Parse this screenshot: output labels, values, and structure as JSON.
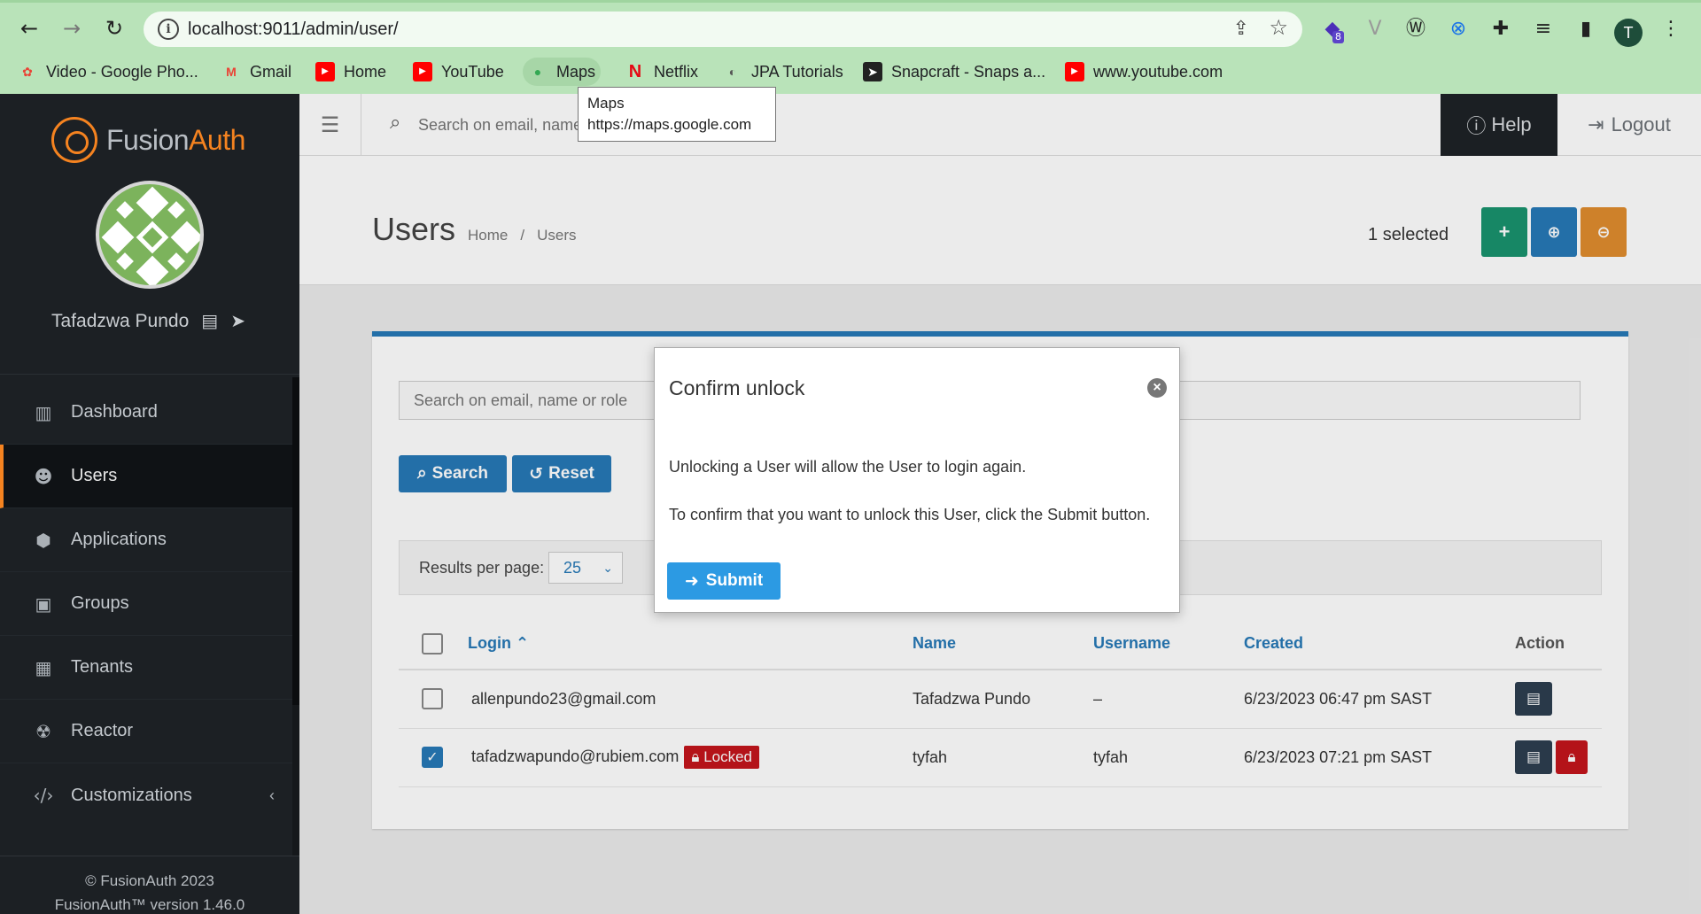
{
  "browser": {
    "url": "localhost:9011/admin/user/",
    "bookmarks": [
      {
        "label": "Video - Google Pho..."
      },
      {
        "label": "Gmail"
      },
      {
        "label": "Home"
      },
      {
        "label": "YouTube"
      },
      {
        "label": "Maps"
      },
      {
        "label": "Netflix"
      },
      {
        "label": "JPA Tutorials"
      },
      {
        "label": "Snapcraft - Snaps a..."
      },
      {
        "label": "www.youtube.com"
      }
    ],
    "extension_badge": "8",
    "profile_initial": "T",
    "tooltip": {
      "title": "Maps",
      "url": "https://maps.google.com"
    }
  },
  "sidebar": {
    "logo_a": "Fusion",
    "logo_b": "Auth",
    "user_name": "Tafadzwa Pundo",
    "items": [
      {
        "label": "Dashboard",
        "icon": "columns-icon"
      },
      {
        "label": "Users",
        "icon": "users-icon"
      },
      {
        "label": "Applications",
        "icon": "cube-icon"
      },
      {
        "label": "Groups",
        "icon": "object-group-icon"
      },
      {
        "label": "Tenants",
        "icon": "building-icon"
      },
      {
        "label": "Reactor",
        "icon": "radiation-icon"
      },
      {
        "label": "Customizations",
        "icon": "code-icon"
      }
    ],
    "footer_line1": "© FusionAuth 2023",
    "footer_line2": "FusionAuth™ version 1.46.0"
  },
  "topbar": {
    "search_placeholder": "Search on email, name or role",
    "help_label": "Help",
    "logout_label": "Logout"
  },
  "page": {
    "title": "Users",
    "breadcrumb_home": "Home",
    "breadcrumb_sep": "/",
    "breadcrumb_current": "Users",
    "selected_count": "1",
    "selected_text": "selected",
    "colors": {
      "add": "#19936e",
      "unlock": "#2779b7",
      "lock": "#e08d2e"
    }
  },
  "search": {
    "placeholder": "Search on email, name or role",
    "search_label": "Search",
    "reset_label": "Reset"
  },
  "results": {
    "label": "Results per page:",
    "value": "25"
  },
  "table": {
    "headers": {
      "login": "Login",
      "name": "Name",
      "username": "Username",
      "created": "Created",
      "action": "Action"
    },
    "rows": [
      {
        "login": "allenpundo23@gmail.com",
        "locked": false,
        "name": "Tafadzwa Pundo",
        "username": "–",
        "created": "6/23/2023 06:47 pm SAST",
        "checked": false
      },
      {
        "login": "tafadzwapundo@rubiem.com",
        "locked": true,
        "locked_label": "Locked",
        "name": "tyfah",
        "username": "tyfah",
        "created": "6/23/2023 07:21 pm SAST",
        "checked": true
      }
    ]
  },
  "modal": {
    "title": "Confirm unlock",
    "line1": "Unlocking a User will allow the User to login again.",
    "line2": "To confirm that you want to unlock this User, click the Submit button.",
    "submit_label": "Submit"
  }
}
